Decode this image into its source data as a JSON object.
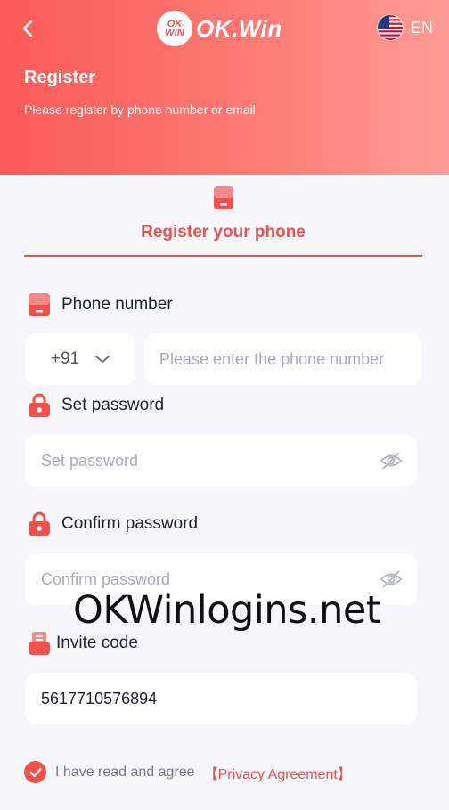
{
  "header": {
    "logo_badge": "OK WIN",
    "logo_text": "OK.Win",
    "language": "EN",
    "title": "Register",
    "subtitle": "Please register by phone number or email"
  },
  "tab": {
    "label": "Register your phone"
  },
  "phone": {
    "label": "Phone number",
    "country_code": "+91",
    "placeholder": "Please enter the phone number"
  },
  "password": {
    "label": "Set password",
    "placeholder": "Set password"
  },
  "confirm": {
    "label": "Confirm password",
    "placeholder": "Confirm password"
  },
  "invite": {
    "label": "Invite code",
    "value": "5617710576894"
  },
  "watermark": "OKWinlogins.net",
  "agreement": {
    "text": "I have read and agree",
    "link": "【Privacy Agreement】"
  },
  "colors": {
    "accent": "#f2504d",
    "background": "#f6f6fb"
  }
}
